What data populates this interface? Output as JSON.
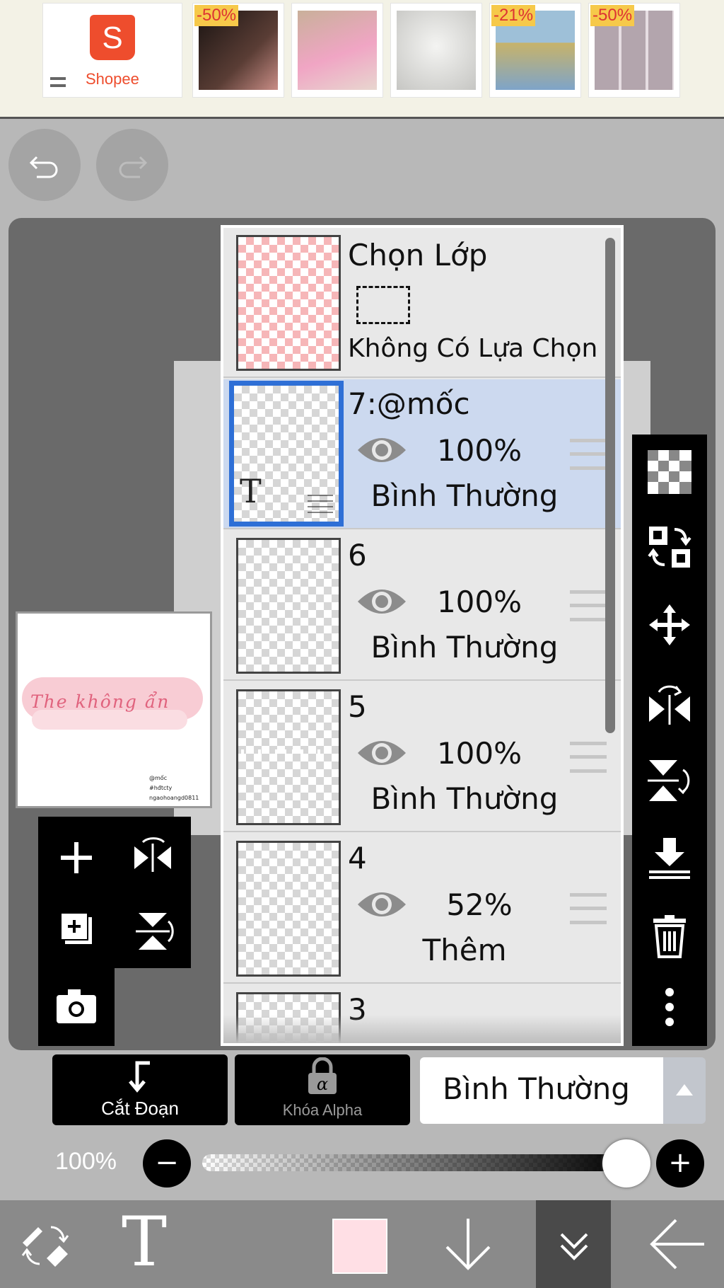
{
  "ad": {
    "brand": "Shopee",
    "products": [
      {
        "discount": "-50%",
        "color": "#2b2321"
      },
      {
        "discount": "",
        "color": "#e9b9c8"
      },
      {
        "discount": "",
        "color": "#d8d8d6"
      },
      {
        "discount": "-21%",
        "color": "#8fb6d6"
      },
      {
        "discount": "-50%",
        "color": "#b7a9b0"
      }
    ]
  },
  "preview": {
    "script_text": "The không ẩn",
    "small_lines": [
      "@mốc",
      "#hđtcty",
      "ngaohoangd0811"
    ]
  },
  "layer_panel": {
    "selection": {
      "title": "Chọn Lớp",
      "subtitle": "Không Có Lựa Chọn"
    },
    "layers": [
      {
        "name": "7:@mốc",
        "opacity": "100%",
        "blend": "Bình Thường",
        "active": true
      },
      {
        "name": "6",
        "opacity": "100%",
        "blend": "Bình Thường",
        "active": false
      },
      {
        "name": "5",
        "opacity": "100%",
        "blend": "Bình Thường",
        "active": false
      },
      {
        "name": "4",
        "opacity": "52%",
        "blend": "Thêm",
        "active": false
      },
      {
        "name": "3",
        "opacity": "",
        "blend": "",
        "active": false
      }
    ]
  },
  "bottom_controls": {
    "clip_label": "Cắt Đoạn",
    "alpha_lock_label": "Khóa Alpha",
    "blend_mode": "Bình Thường",
    "opacity_label": "100%",
    "opacity_value": 1.0
  },
  "colors": {
    "accent": "#2e6fd6",
    "shopee": "#ee4d2d",
    "current_color": "#ffdfe5"
  }
}
